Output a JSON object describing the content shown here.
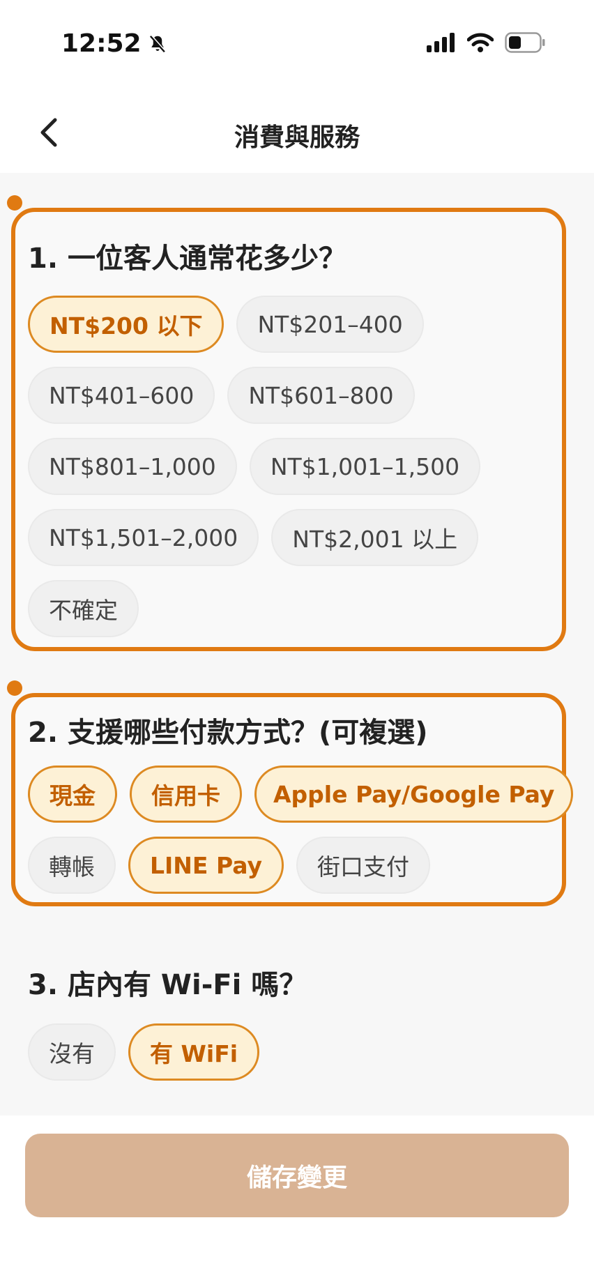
{
  "status_bar": {
    "time": "12:52",
    "icons": [
      "bell-slash-icon",
      "signal-icon",
      "wifi-icon",
      "battery-icon"
    ]
  },
  "header": {
    "title": "消費與服務",
    "back_icon": "chevron-left-icon"
  },
  "sections": [
    {
      "title": "1. 一位客人通常花多少？",
      "highlighted": true,
      "options": [
        {
          "label": "NT$200 以下",
          "selected": true
        },
        {
          "label": "NT$201–400",
          "selected": false
        },
        {
          "label": "NT$401–600",
          "selected": false
        },
        {
          "label": "NT$601–800",
          "selected": false
        },
        {
          "label": "NT$801–1,000",
          "selected": false
        },
        {
          "label": "NT$1,001–1,500",
          "selected": false
        },
        {
          "label": "NT$1,501–2,000",
          "selected": false
        },
        {
          "label": "NT$2,001 以上",
          "selected": false
        },
        {
          "label": "不確定",
          "selected": false
        }
      ]
    },
    {
      "title": "2. 支援哪些付款方式？(可複選)",
      "highlighted": true,
      "options": [
        {
          "label": "現金",
          "selected": true
        },
        {
          "label": "信用卡",
          "selected": true
        },
        {
          "label": "Apple Pay/Google Pay",
          "selected": true
        },
        {
          "label": "轉帳",
          "selected": false
        },
        {
          "label": "LINE Pay",
          "selected": true
        },
        {
          "label": "街口支付",
          "selected": false
        }
      ]
    },
    {
      "title": "3. 店內有 Wi-Fi 嗎？",
      "highlighted": false,
      "options": [
        {
          "label": "沒有",
          "selected": false
        },
        {
          "label": "有 WiFi",
          "selected": true
        }
      ]
    }
  ],
  "save_button": {
    "label": "儲存變更"
  },
  "colors": {
    "accent": "#e07a12",
    "chip_selected_bg": "#fdf1d6",
    "chip_selected_text": "#c25f00",
    "save_button_bg": "#d9b394"
  }
}
